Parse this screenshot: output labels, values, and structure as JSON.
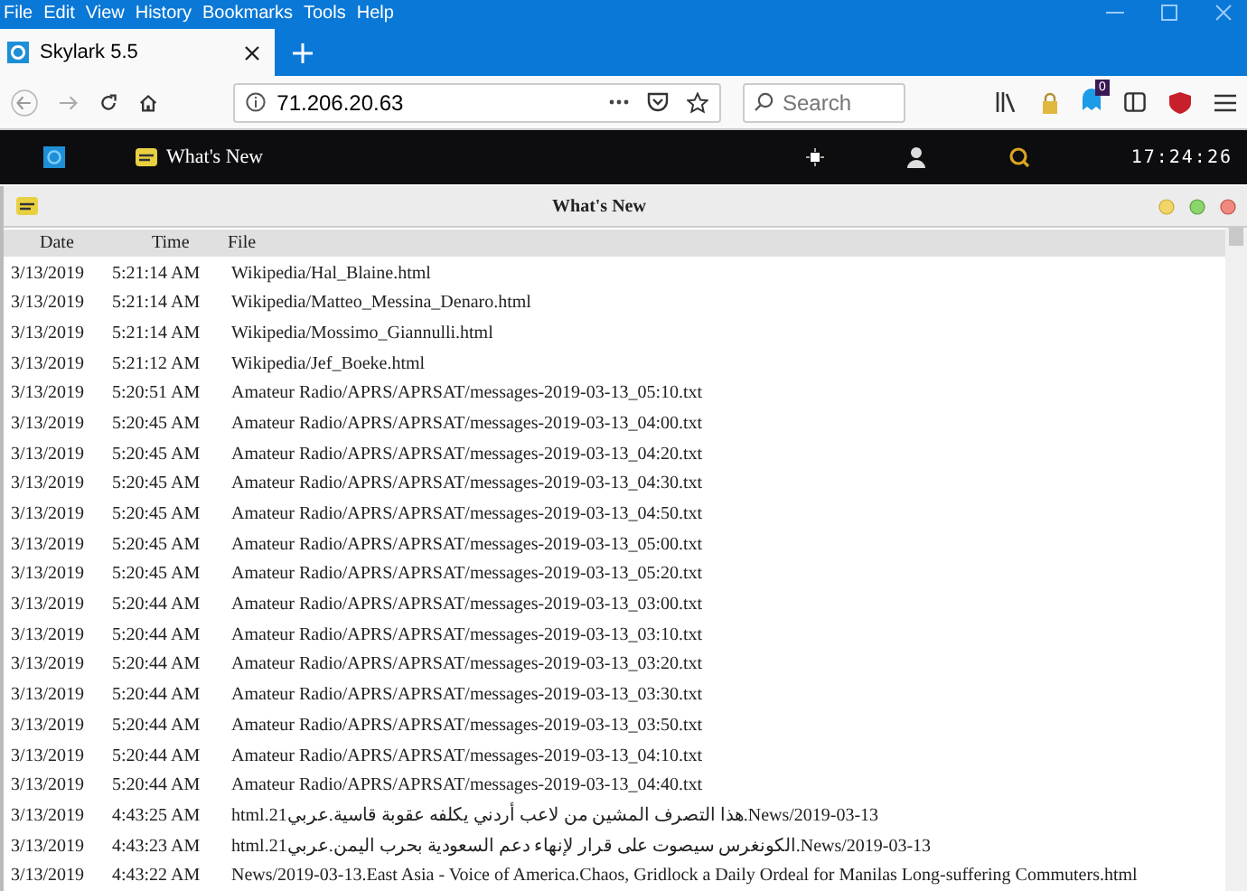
{
  "menu_bar": [
    "File",
    "Edit",
    "View",
    "History",
    "Bookmarks",
    "Tools",
    "Help"
  ],
  "tabs": [
    {
      "label": "Skylark 5.5",
      "selected": true
    }
  ],
  "address_bar": {
    "value": "71.206.20.63"
  },
  "search": {
    "placeholder": "Search"
  },
  "toolbar_badge": "0",
  "app_bar": {
    "item": "What's New",
    "clock": "17:24:26"
  },
  "window": {
    "title": "What's New"
  },
  "table": {
    "columns": [
      "Date",
      "Time",
      "File"
    ],
    "rows": [
      [
        "3/13/2019",
        "5:21:14 AM",
        "Wikipedia/Hal_Blaine.html"
      ],
      [
        "3/13/2019",
        "5:21:14 AM",
        "Wikipedia/Matteo_Messina_Denaro.html"
      ],
      [
        "3/13/2019",
        "5:21:14 AM",
        "Wikipedia/Mossimo_Giannulli.html"
      ],
      [
        "3/13/2019",
        "5:21:12 AM",
        "Wikipedia/Jef_Boeke.html"
      ],
      [
        "3/13/2019",
        "5:20:51 AM",
        "Amateur Radio/APRS/APRSAT/messages-2019-03-13_05:10.txt"
      ],
      [
        "3/13/2019",
        "5:20:45 AM",
        "Amateur Radio/APRS/APRSAT/messages-2019-03-13_04:00.txt"
      ],
      [
        "3/13/2019",
        "5:20:45 AM",
        "Amateur Radio/APRS/APRSAT/messages-2019-03-13_04:20.txt"
      ],
      [
        "3/13/2019",
        "5:20:45 AM",
        "Amateur Radio/APRS/APRSAT/messages-2019-03-13_04:30.txt"
      ],
      [
        "3/13/2019",
        "5:20:45 AM",
        "Amateur Radio/APRS/APRSAT/messages-2019-03-13_04:50.txt"
      ],
      [
        "3/13/2019",
        "5:20:45 AM",
        "Amateur Radio/APRS/APRSAT/messages-2019-03-13_05:00.txt"
      ],
      [
        "3/13/2019",
        "5:20:45 AM",
        "Amateur Radio/APRS/APRSAT/messages-2019-03-13_05:20.txt"
      ],
      [
        "3/13/2019",
        "5:20:44 AM",
        "Amateur Radio/APRS/APRSAT/messages-2019-03-13_03:00.txt"
      ],
      [
        "3/13/2019",
        "5:20:44 AM",
        "Amateur Radio/APRS/APRSAT/messages-2019-03-13_03:10.txt"
      ],
      [
        "3/13/2019",
        "5:20:44 AM",
        "Amateur Radio/APRS/APRSAT/messages-2019-03-13_03:20.txt"
      ],
      [
        "3/13/2019",
        "5:20:44 AM",
        "Amateur Radio/APRS/APRSAT/messages-2019-03-13_03:30.txt"
      ],
      [
        "3/13/2019",
        "5:20:44 AM",
        "Amateur Radio/APRS/APRSAT/messages-2019-03-13_03:50.txt"
      ],
      [
        "3/13/2019",
        "5:20:44 AM",
        "Amateur Radio/APRS/APRSAT/messages-2019-03-13_04:10.txt"
      ],
      [
        "3/13/2019",
        "5:20:44 AM",
        "Amateur Radio/APRS/APRSAT/messages-2019-03-13_04:40.txt"
      ],
      [
        "3/13/2019",
        "4:43:25 AM",
        "News/2019-03-13.هذا التصرف المشين من لاعب أردني يكلفه عقوبة قاسية.عربي21.html"
      ],
      [
        "3/13/2019",
        "4:43:23 AM",
        "News/2019-03-13.الكونغرس سيصوت على قرار لإنهاء دعم السعودية بحرب اليمن.عربي21.html"
      ],
      [
        "3/13/2019",
        "4:43:22 AM",
        "News/2019-03-13.East Asia - Voice of America.Chaos, Gridlock a Daily Ordeal for Manilas Long-suffering Commuters.html"
      ]
    ]
  }
}
